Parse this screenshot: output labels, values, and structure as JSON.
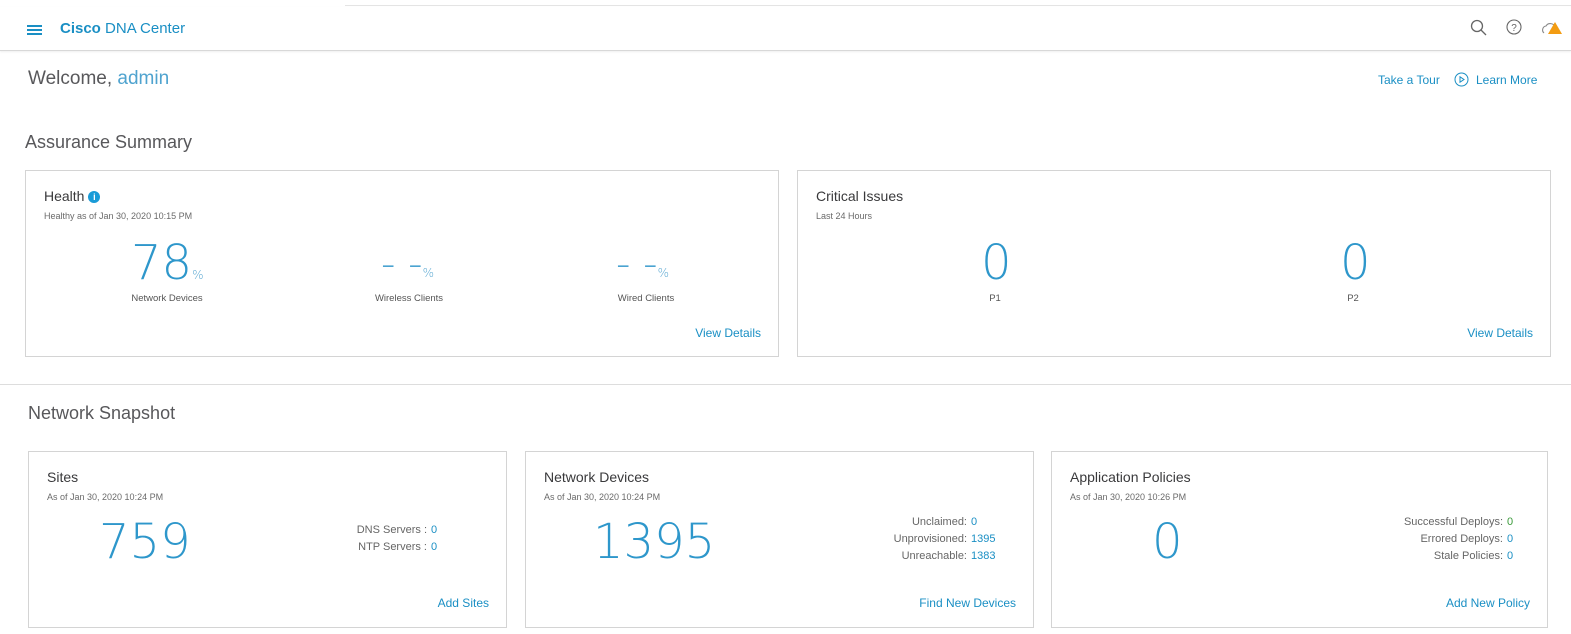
{
  "header": {
    "brand_bold": "Cisco",
    "brand_rest": "DNA Center",
    "icons": [
      "search-icon",
      "help-icon",
      "cloud-warning-icon"
    ]
  },
  "welcome": {
    "prefix": "Welcome,",
    "user": "admin",
    "tour": "Take a Tour",
    "learn": "Learn More"
  },
  "assurance": {
    "title": "Assurance Summary",
    "health": {
      "title": "Health",
      "subtitle": "Healthy as of Jan 30, 2020 10:15 PM",
      "items": [
        {
          "value": "78",
          "unit": "%",
          "label": "Network Devices"
        },
        {
          "value": "- -",
          "unit": "%",
          "label": "Wireless Clients"
        },
        {
          "value": "- -",
          "unit": "%",
          "label": "Wired Clients"
        }
      ],
      "link": "View Details"
    },
    "issues": {
      "title": "Critical Issues",
      "subtitle": "Last 24 Hours",
      "items": [
        {
          "value": "0",
          "label": "P1"
        },
        {
          "value": "0",
          "label": "P2"
        }
      ],
      "link": "View Details"
    }
  },
  "snapshot": {
    "title": "Network Snapshot",
    "sites": {
      "title": "Sites",
      "subtitle": "As of Jan 30, 2020 10:24 PM",
      "value": "759",
      "stats": [
        {
          "label": "DNS Servers :",
          "value": "0"
        },
        {
          "label": "NTP Servers :",
          "value": "0"
        }
      ],
      "link": "Add Sites"
    },
    "devices": {
      "title": "Network Devices",
      "subtitle": "As of Jan 30, 2020 10:24 PM",
      "value": "1395",
      "stats": [
        {
          "label": "Unclaimed:",
          "value": "0"
        },
        {
          "label": "Unprovisioned:",
          "value": "1395"
        },
        {
          "label": "Unreachable:",
          "value": "1383"
        }
      ],
      "link": "Find New Devices"
    },
    "policies": {
      "title": "Application Policies",
      "subtitle": "As of Jan 30, 2020 10:26 PM",
      "value": "0",
      "stats": [
        {
          "label": "Successful Deploys:",
          "value": "0"
        },
        {
          "label": "Errored Deploys:",
          "value": "0"
        },
        {
          "label": "Stale Policies:",
          "value": "0"
        }
      ],
      "link": "Add New Policy"
    }
  },
  "colors": {
    "accent": "#1a8fc4",
    "success": "#3a9a3a",
    "warning": "#f39c12"
  }
}
